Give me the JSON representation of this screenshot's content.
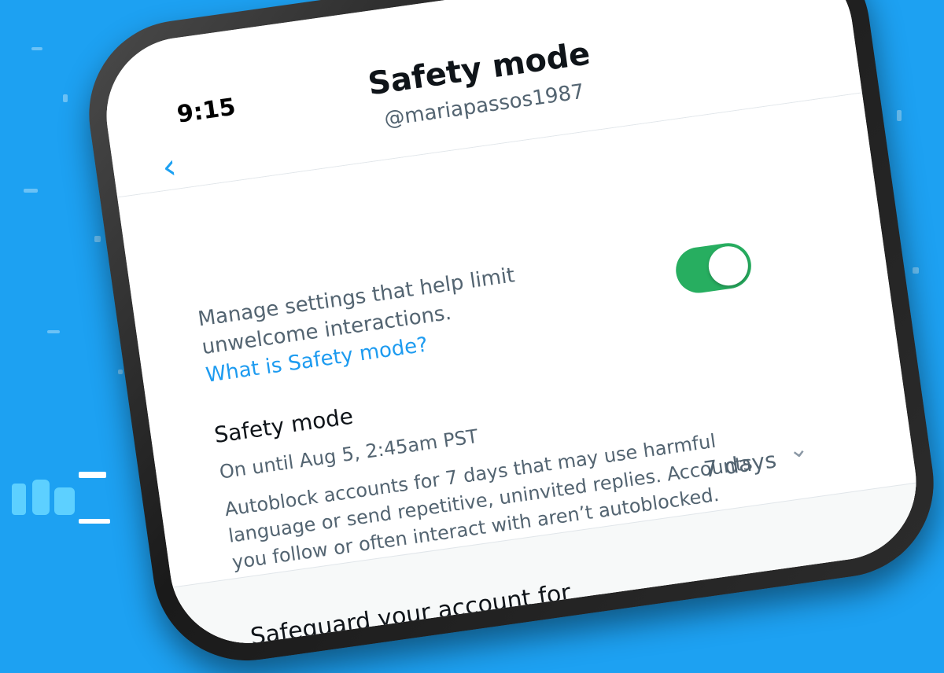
{
  "status_bar": {
    "time": "9:15"
  },
  "header": {
    "title": "Safety mode",
    "handle": "@mariapassos1987",
    "back_icon": "chevron-left-icon"
  },
  "intro": {
    "description": "Manage settings that help limit unwelcome interactions.",
    "link": "What is Safety mode?",
    "toggle_on": true
  },
  "safety_section": {
    "title": "Safety mode",
    "status": "On until Aug 5, 2:45am PST",
    "body": "Autoblock accounts for 7 days that may use harmful language or send repetitive, uninvited replies. Accounts you follow or often interact with aren’t autoblocked."
  },
  "duration": {
    "value": "7 days",
    "chevron_icon": "chevron-down-icon"
  },
  "safeguard": {
    "label": "Safeguard your account for"
  },
  "colors": {
    "background": "#1da1f2",
    "toggle_on": "#27ae60",
    "link": "#1d9bf0"
  }
}
